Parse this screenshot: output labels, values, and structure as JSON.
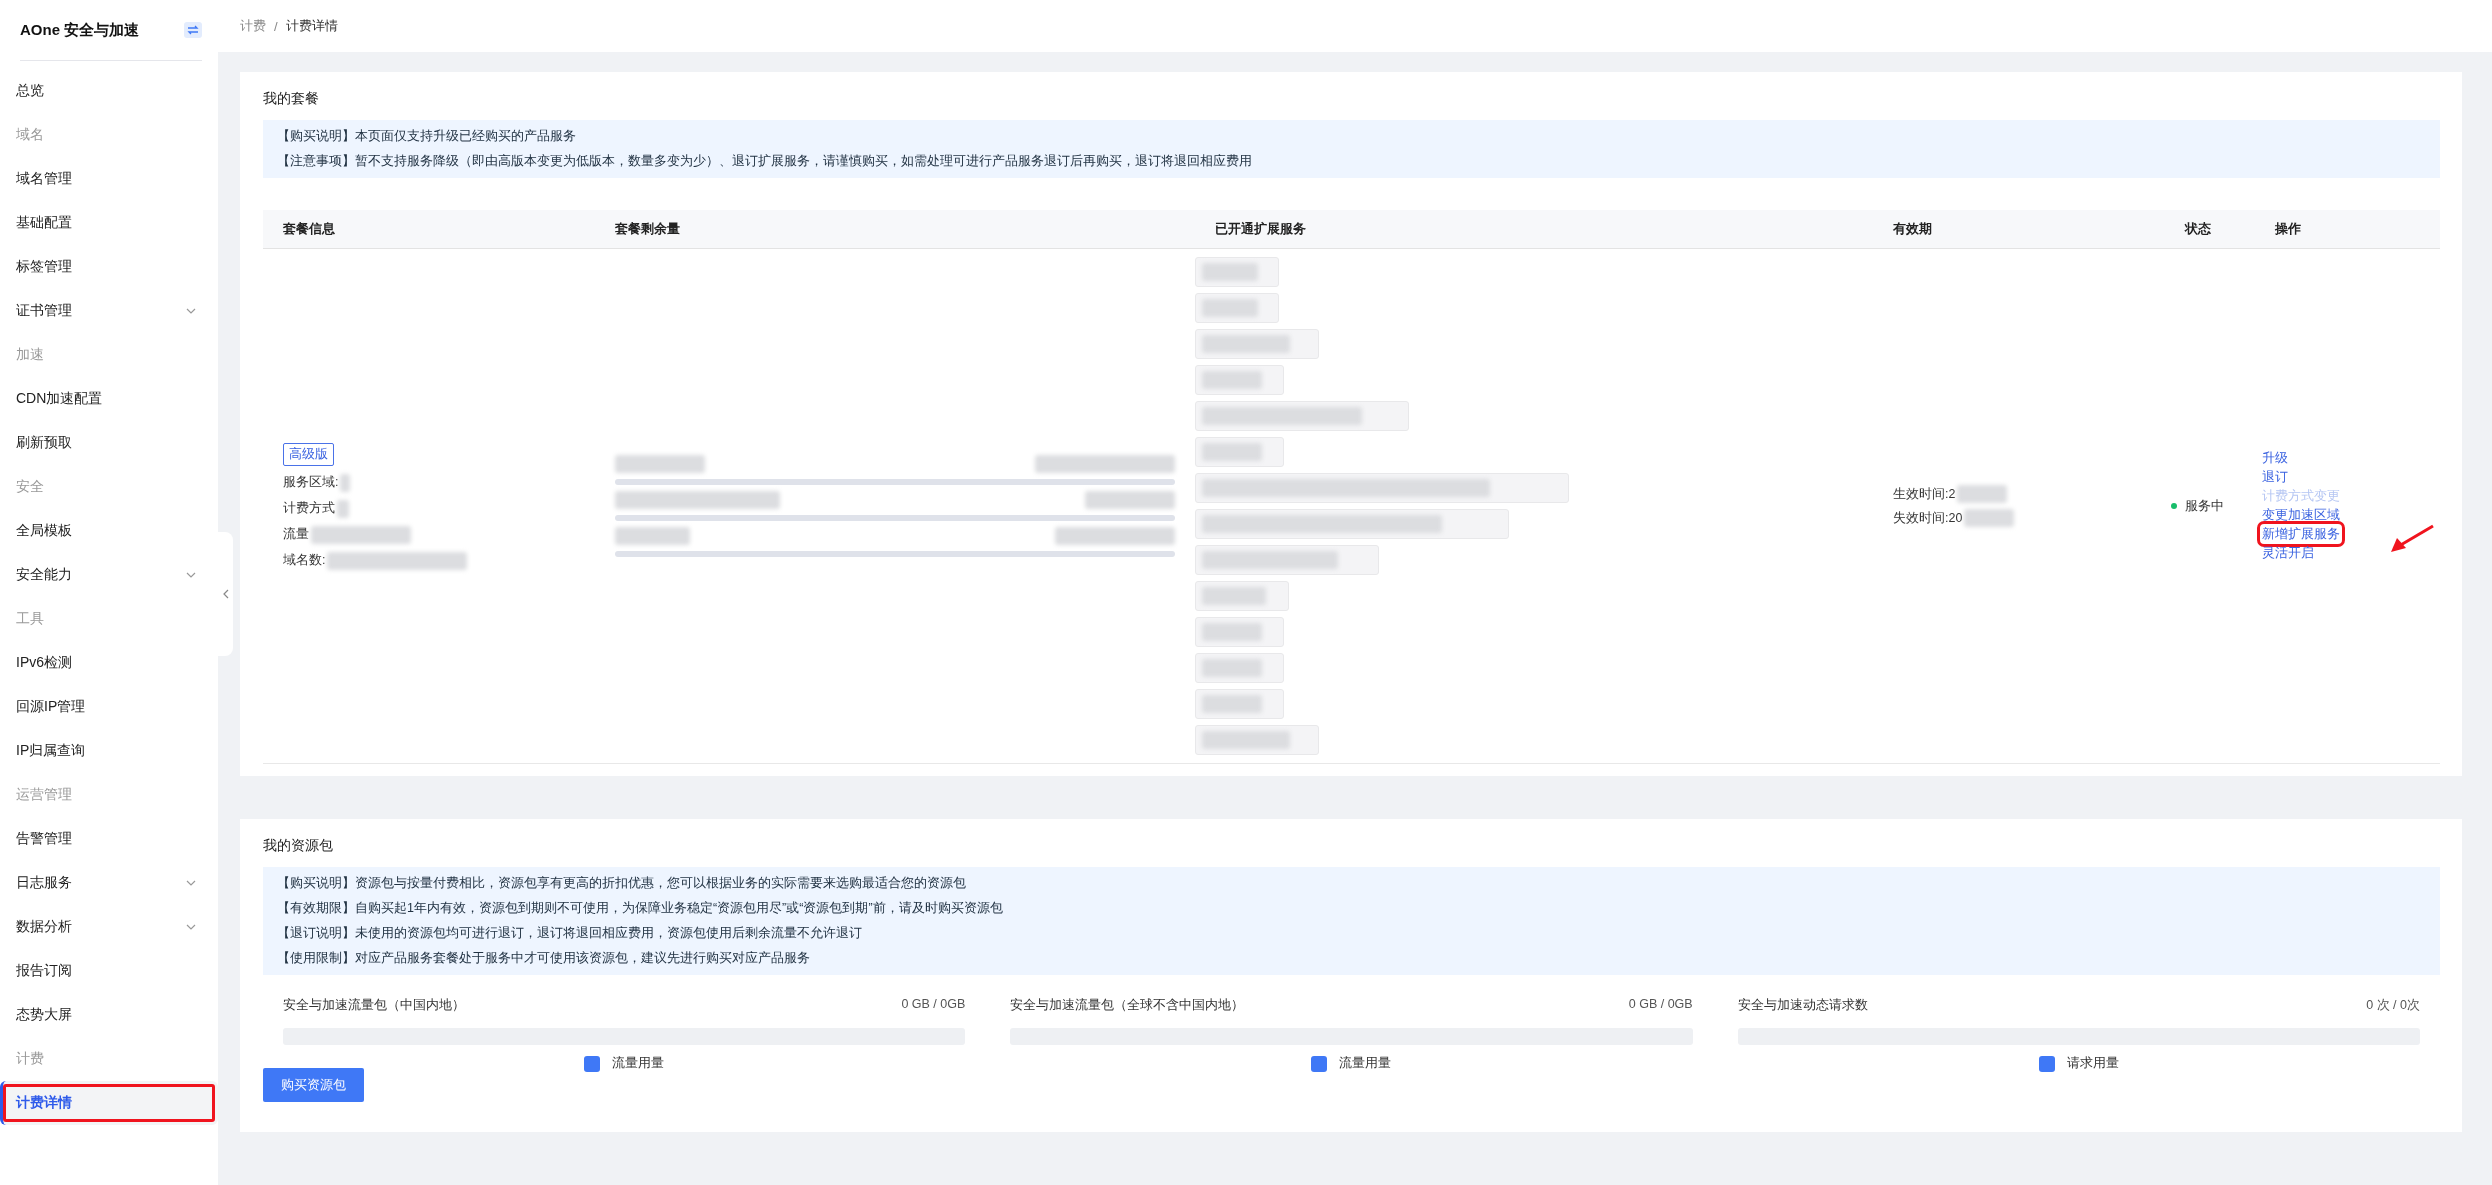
{
  "sidebar": {
    "title": "AOne 安全与加速",
    "items": [
      {
        "kind": "item",
        "label": "总览",
        "expandable": false,
        "selected": false,
        "highlighted": false
      },
      {
        "kind": "group",
        "label": "域名"
      },
      {
        "kind": "item",
        "label": "域名管理",
        "expandable": false,
        "selected": false,
        "highlighted": false
      },
      {
        "kind": "item",
        "label": "基础配置",
        "expandable": false,
        "selected": false,
        "highlighted": false
      },
      {
        "kind": "item",
        "label": "标签管理",
        "expandable": false,
        "selected": false,
        "highlighted": false
      },
      {
        "kind": "item",
        "label": "证书管理",
        "expandable": true,
        "selected": false,
        "highlighted": false
      },
      {
        "kind": "group",
        "label": "加速"
      },
      {
        "kind": "item",
        "label": "CDN加速配置",
        "expandable": false,
        "selected": false,
        "highlighted": false
      },
      {
        "kind": "item",
        "label": "刷新预取",
        "expandable": false,
        "selected": false,
        "highlighted": false
      },
      {
        "kind": "group",
        "label": "安全"
      },
      {
        "kind": "item",
        "label": "全局模板",
        "expandable": false,
        "selected": false,
        "highlighted": false
      },
      {
        "kind": "item",
        "label": "安全能力",
        "expandable": true,
        "selected": false,
        "highlighted": false
      },
      {
        "kind": "group",
        "label": "工具"
      },
      {
        "kind": "item",
        "label": "IPv6检测",
        "expandable": false,
        "selected": false,
        "highlighted": false
      },
      {
        "kind": "item",
        "label": "回源IP管理",
        "expandable": false,
        "selected": false,
        "highlighted": false
      },
      {
        "kind": "item",
        "label": "IP归属查询",
        "expandable": false,
        "selected": false,
        "highlighted": false
      },
      {
        "kind": "group",
        "label": "运营管理"
      },
      {
        "kind": "item",
        "label": "告警管理",
        "expandable": false,
        "selected": false,
        "highlighted": false
      },
      {
        "kind": "item",
        "label": "日志服务",
        "expandable": true,
        "selected": false,
        "highlighted": false
      },
      {
        "kind": "item",
        "label": "数据分析",
        "expandable": true,
        "selected": false,
        "highlighted": false
      },
      {
        "kind": "item",
        "label": "报告订阅",
        "expandable": false,
        "selected": false,
        "highlighted": false
      },
      {
        "kind": "item",
        "label": "态势大屏",
        "expandable": false,
        "selected": false,
        "highlighted": false
      },
      {
        "kind": "group",
        "label": "计费"
      },
      {
        "kind": "item",
        "label": "计费详情",
        "expandable": false,
        "selected": true,
        "highlighted": true
      }
    ]
  },
  "breadcrumb": {
    "items": [
      "计费",
      "计费详情"
    ],
    "separator": "/"
  },
  "package": {
    "title": "我的套餐",
    "notices": [
      "【购买说明】本页面仅支持升级已经购买的产品服务",
      "【注意事项】暂不支持服务降级（即由高版本变更为低版本，数量多变为少）、退订扩展服务，请谨慎购买，如需处理可进行产品服务退订后再购买，退订将退回相应费用"
    ],
    "table": {
      "columns": [
        "套餐信息",
        "套餐剩余量",
        "已开通扩展服务",
        "有效期",
        "状态",
        "操作"
      ],
      "row": {
        "badge": "高级版",
        "info": [
          "服务区域:",
          "计费方式",
          "流量",
          "域名数:"
        ],
        "remaining": [
          {
            "kind": "blurred"
          },
          {
            "kind": "blurred"
          },
          {
            "kind": "blurred"
          }
        ],
        "services": [
          {
            "kind": "blurred"
          },
          {
            "kind": "blurred"
          },
          {
            "kind": "blurred"
          },
          {
            "kind": "blurred"
          },
          {
            "kind": "blurred"
          },
          {
            "kind": "blurred"
          },
          {
            "kind": "blurred"
          },
          {
            "kind": "blurred"
          },
          {
            "kind": "blurred"
          },
          {
            "kind": "blurred"
          },
          {
            "kind": "blurred"
          },
          {
            "kind": "blurred"
          },
          {
            "kind": "blurred"
          },
          {
            "kind": "blurred"
          }
        ],
        "validity": [
          "生效时间:2",
          "失效时间:20"
        ],
        "status": {
          "text": "服务中",
          "active": true
        },
        "actions": [
          {
            "label": "升级",
            "disabled": false,
            "highlighted": false
          },
          {
            "label": "退订",
            "disabled": false,
            "highlighted": false
          },
          {
            "label": "计费方式变更",
            "disabled": true,
            "highlighted": false
          },
          {
            "label": "变更加速区域",
            "disabled": false,
            "highlighted": false
          },
          {
            "label": "新增扩展服务",
            "disabled": false,
            "highlighted": true
          },
          {
            "label": "灵活开启",
            "disabled": false,
            "highlighted": false
          }
        ]
      }
    }
  },
  "resources": {
    "title": "我的资源包",
    "notices": [
      "【购买说明】资源包与按量付费相比，资源包享有更高的折扣优惠，您可以根据业务的实际需要来选购最适合您的资源包",
      "【有效期限】自购买起1年内有效，资源包到期则不可使用，为保障业务稳定“资源包用尽”或“资源包到期”前，请及时购买资源包",
      "【退订说明】未使用的资源包均可进行退订，退订将退回相应费用，资源包使用后剩余流量不允许退订",
      "【使用限制】对应产品服务套餐处于服务中才可使用该资源包，建议先进行购买对应产品服务"
    ],
    "packs": [
      {
        "name": "安全与加速流量包（中国内地）",
        "usage": "0 GB / 0GB",
        "level": 0,
        "legend": "流量用量"
      },
      {
        "name": "安全与加速流量包（全球不含中国内地）",
        "usage": "0 GB / 0GB",
        "level": 0,
        "legend": "流量用量"
      },
      {
        "name": "安全与加速动态请求数",
        "usage": "0 次 / 0次",
        "level": 0,
        "legend": "请求用量"
      }
    ],
    "button": "购买资源包"
  }
}
